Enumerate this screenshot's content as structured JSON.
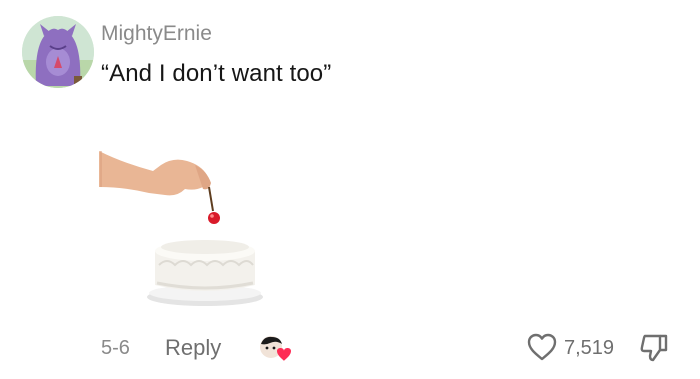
{
  "comment": {
    "username": "MightyErnie",
    "text": "“And I don’t want too”",
    "date": "5-6",
    "reply_label": "Reply",
    "like_count": "7,519"
  },
  "icons": {
    "avatar": "purple-monster-avatar",
    "media": "hand-placing-cherry-on-cake",
    "creator_liked": "creator-liked-heart-icon",
    "like": "heart-outline-icon",
    "dislike": "thumbs-down-icon"
  },
  "colors": {
    "username": "#8a8a8a",
    "text": "#161616",
    "heart_badge": "#fe2c55"
  }
}
